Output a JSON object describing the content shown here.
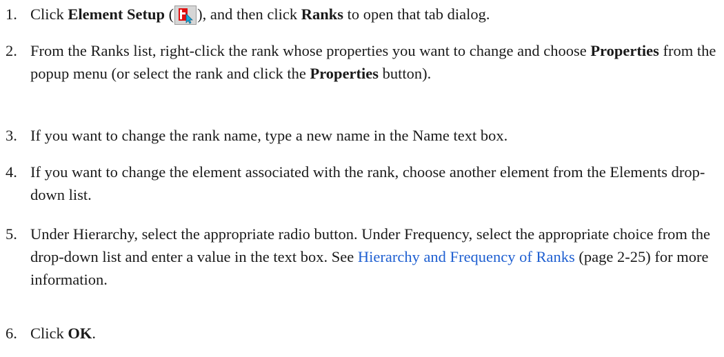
{
  "steps": [
    {
      "number": "1.",
      "parts": {
        "a": "Click ",
        "b": "Element Setup",
        "c": " (",
        "d": "), and then click ",
        "e": "Ranks",
        "f": " to open that tab dialog."
      }
    },
    {
      "number": "2.",
      "parts": {
        "a": "From the Ranks list, right-click the rank whose properties you want to change and choose ",
        "b": "Properties",
        "c": " from the popup menu (or select the rank and click the ",
        "d": "Properties",
        "e": " button)."
      }
    },
    {
      "number": "3.",
      "text": "If you want to change the rank name, type a new name in the Name text box."
    },
    {
      "number": "4.",
      "text": "If you want to change the element associated with the rank, choose another element from the Elements drop-down list."
    },
    {
      "number": "5.",
      "parts": {
        "a": "Under Hierarchy, select the appropriate radio button. Under Frequency, select the appropriate choice from the drop-down list and enter a value in the text box. See ",
        "link": "Hierarchy and Frequency of Ranks",
        "b": " (page 2-25) for more information."
      }
    },
    {
      "number": "6.",
      "parts": {
        "a": "Click ",
        "b": "OK",
        "c": "."
      }
    }
  ],
  "icons": {
    "element_setup": "element-setup-icon"
  },
  "colors": {
    "text": "#1a1a1a",
    "link": "#1e5fd1",
    "icon_red": "#e01010",
    "icon_cursor": "#16a8d8"
  }
}
